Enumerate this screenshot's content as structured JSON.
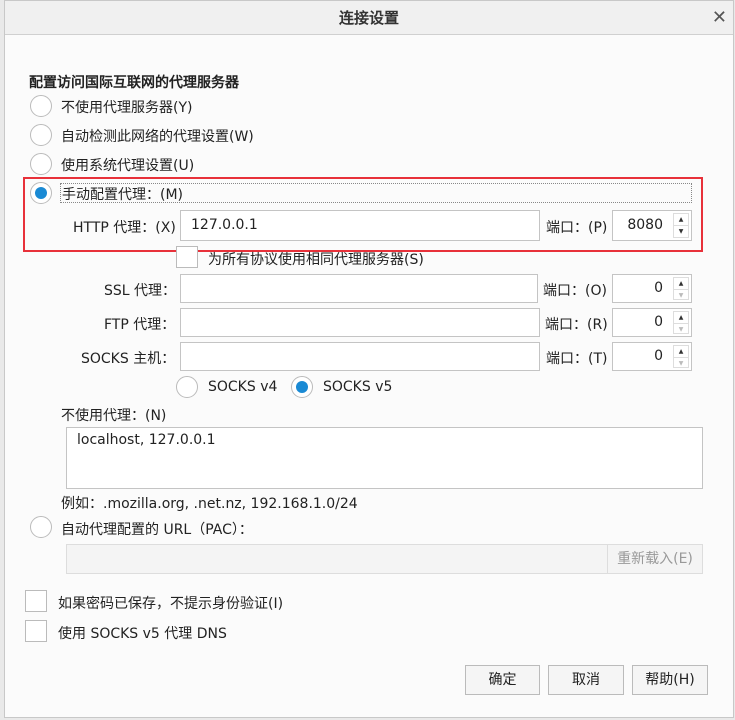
{
  "title": "连接设置",
  "heading": "配置访问国际互联网的代理服务器",
  "radios": {
    "none": "不使用代理服务器(Y)",
    "auto": "自动检测此网络的代理设置(W)",
    "system": "使用系统代理设置(U)",
    "manual": "手动配置代理：(M)",
    "pac": "自动代理配置的 URL（PAC）："
  },
  "http": {
    "label": "HTTP 代理：(X)",
    "value": "127.0.0.1",
    "port_label": "端口：(P)",
    "port": "8080"
  },
  "same_proxy": "为所有协议使用相同代理服务器(S)",
  "ssl": {
    "label": "SSL 代理：",
    "value": "",
    "port_label": "端口：(O)",
    "port": "0"
  },
  "ftp": {
    "label": "FTP 代理：",
    "value": "",
    "port_label": "端口：(R)",
    "port": "0"
  },
  "socks": {
    "label": "SOCKS 主机：",
    "value": "",
    "port_label": "端口：(T)",
    "port": "0",
    "v4": "SOCKS v4",
    "v5": "SOCKS v5"
  },
  "no_proxy": {
    "label": "不使用代理：(N)",
    "value": "localhost, 127.0.0.1",
    "example": "例如：.mozilla.org, .net.nz, 192.168.1.0/24"
  },
  "pac": {
    "value": "",
    "reload": "重新载入(E)"
  },
  "checks": {
    "no_auth": "如果密码已保存，不提示身份验证(I)",
    "socks_dns": "使用 SOCKS v5 代理 DNS"
  },
  "buttons": {
    "ok": "确定",
    "cancel": "取消",
    "help": "帮助(H)"
  },
  "colors": {
    "accent": "#1a8ad4",
    "highlight": "#e8313a"
  }
}
